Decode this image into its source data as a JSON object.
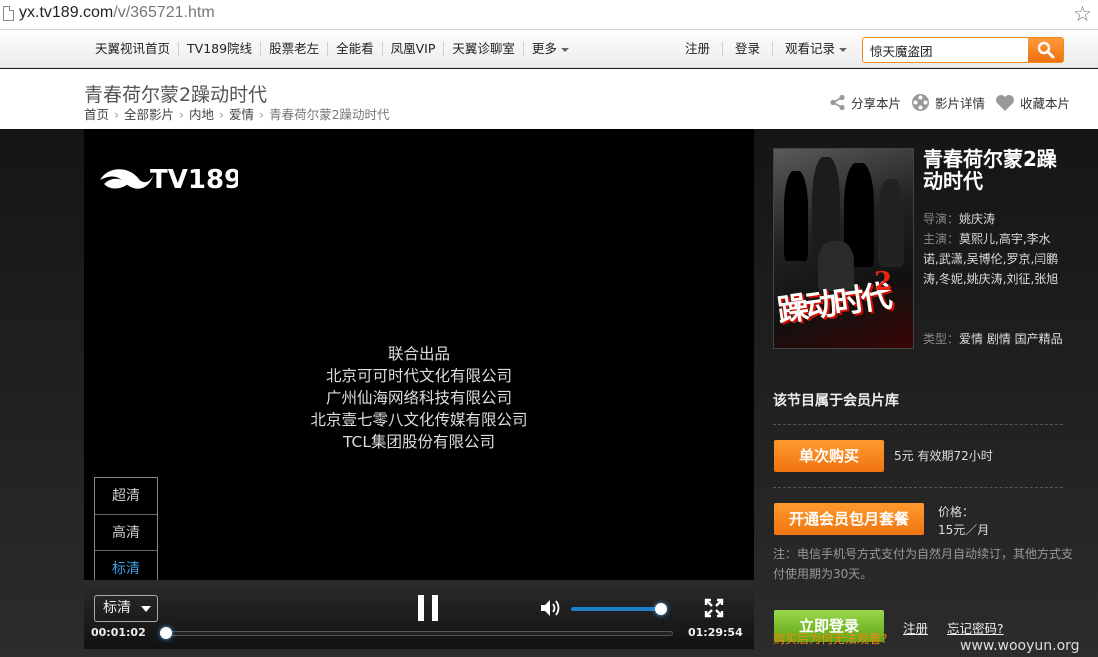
{
  "address": {
    "host": "yx.tv189.com",
    "path": "/v/365721.htm"
  },
  "nav": {
    "items": [
      "天翼视讯首页",
      "TV189院线",
      "股票老左",
      "全能看",
      "凤凰VIP",
      "天翼诊聊室",
      "更多"
    ],
    "right": [
      "注册",
      "登录",
      "观看记录"
    ],
    "search_value": "惊天魔盗团"
  },
  "page": {
    "title": "青春荷尔蒙2躁动时代",
    "breadcrumb": [
      "首页",
      "全部影片",
      "内地",
      "爱情",
      "青春荷尔蒙2躁动时代"
    ],
    "actions": [
      "分享本片",
      "影片详情",
      "收藏本片"
    ]
  },
  "player": {
    "logo": "TV189",
    "credits": [
      "联合出品",
      "北京可可时代文化有限公司",
      "广州仙海网络科技有限公司",
      "北京壹七零八文化传媒有限公司",
      "TCL集团股份有限公司"
    ],
    "quality_options": [
      "超清",
      "高清",
      "标清"
    ],
    "quality_selected": "标清",
    "time_current": "00:01:02",
    "time_total": "01:29:54",
    "progress": 0.012,
    "volume": 1.0
  },
  "movie": {
    "title": "青春荷尔蒙2躁动时代",
    "poster_text": "躁动时代",
    "poster_num": "2",
    "director_label": "导演：",
    "director": "姚庆涛",
    "cast_label": "主演：",
    "cast": "莫熙儿,高宇,李水诺,武潇,吴博伦,罗京,闫鹏涛,冬妮,姚庆涛,刘征,张旭",
    "genre_label": "类型：",
    "genre": "爱情 剧情 国产精品"
  },
  "purchase": {
    "member_text": "该节目属于会员片库",
    "single_btn": "单次购买",
    "single_desc": "5元 有效期72小时",
    "monthly_btn": "开通会员包月套餐",
    "price_label": "价格：",
    "price": "15元／月",
    "note": "注：电信手机号方式支付为自然月自动续订，其他方式支付使用期为30天。",
    "login_btn": "立即登录",
    "register": "注册",
    "forgot": "忘记密码?",
    "warning": "购买后为何无法观看?"
  },
  "watermark": "www.wooyun.org",
  "colors": {
    "accent": "#f07a14",
    "highlight": "#3aa0e6",
    "login": "#6db424"
  }
}
